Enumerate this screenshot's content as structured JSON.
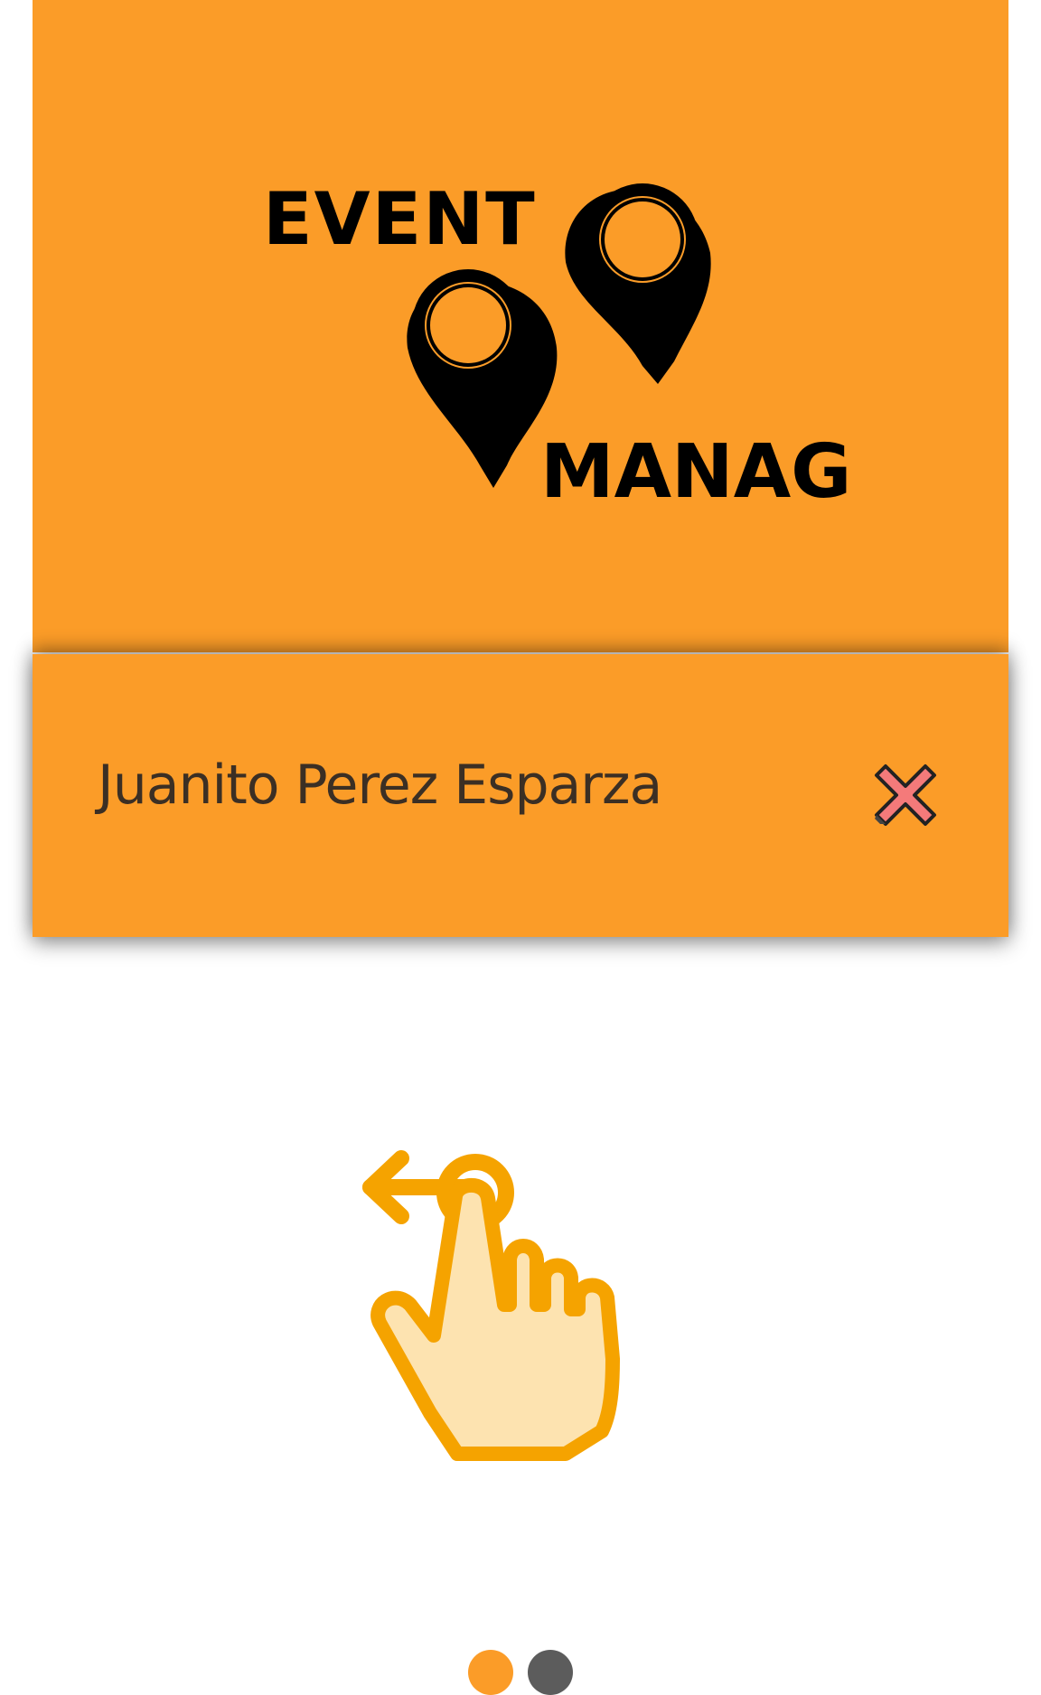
{
  "logo": {
    "top_word": "EVENT",
    "bottom_word": "MANAGER",
    "icon": "map-pin-icon"
  },
  "card": {
    "name": "Juanito Perez Esparza",
    "close_icon": "close-icon"
  },
  "swipe_hint": {
    "icon": "swipe-left-hand-icon"
  },
  "pager": {
    "total_pages": 2,
    "active_index": 0
  },
  "colors": {
    "brand_orange": "#fb9c28",
    "name_text": "#3b2f24",
    "hand_stroke": "#f5a300",
    "hand_fill": "#fde3b0",
    "close_fill": "#f47a7a",
    "dot_inactive": "#5c5c5c"
  }
}
